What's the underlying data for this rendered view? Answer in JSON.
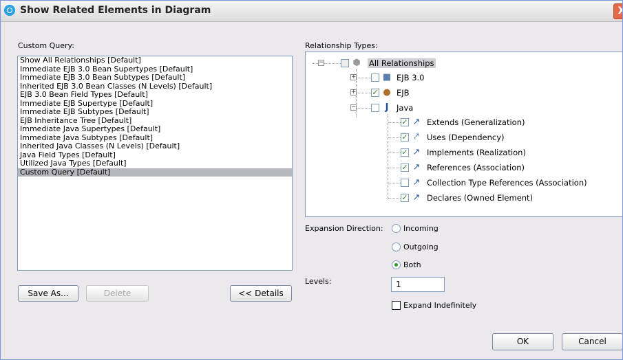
{
  "window": {
    "title": "Show Related Elements in Diagram",
    "close_glyph": "X"
  },
  "custom_query": {
    "label": "Custom Query:",
    "items": [
      "Show All Relationships [Default]",
      "Immediate EJB 3.0 Bean Supertypes [Default]",
      "Immediate EJB 3.0 Bean Subtypes [Default]",
      "Inherited EJB 3.0 Bean Classes (N Levels) [Default]",
      "EJB 3.0 Bean Field Types [Default]",
      "Immediate EJB Supertype [Default]",
      "Immediate EJB Subtypes [Default]",
      "EJB Inheritance Tree [Default]",
      "Immediate Java Supertypes [Default]",
      "Immediate Java Subtypes [Default]",
      "Inherited Java Classes (N Levels) [Default]",
      "Java Field Types [Default]",
      "Utilized Java Types [Default]",
      "Custom Query [Default]"
    ],
    "selected_item": "Custom Query [Default]"
  },
  "buttons": {
    "save_as": "Save As...",
    "delete": "Delete",
    "details": "<< Details",
    "ok": "OK",
    "cancel": "Cancel"
  },
  "relationship_types": {
    "label": "Relationship Types:",
    "root": "All Relationships",
    "ejb30": "EJB 3.0",
    "ejb": "EJB",
    "java": "Java",
    "java_children": [
      {
        "label": "Extends (Generalization)",
        "checked": true
      },
      {
        "label": "Uses (Dependency)",
        "checked": true
      },
      {
        "label": "Implements (Realization)",
        "checked": true
      },
      {
        "label": "References (Association)",
        "checked": true
      },
      {
        "label": "Collection Type References (Association)",
        "checked": false
      },
      {
        "label": "Declares (Owned Element)",
        "checked": true
      }
    ]
  },
  "expansion": {
    "label": "Expansion Direction:",
    "options": [
      "Incoming",
      "Outgoing",
      "Both"
    ],
    "selected": "Both"
  },
  "levels": {
    "label": "Levels:",
    "value": "1",
    "expand_indefinitely_label": "Expand Indefinitely",
    "expand_indefinitely_checked": false
  },
  "colors": {
    "accent": "#2aa2e0",
    "selection": "#b6b6bd",
    "check": "#2a7a2a"
  }
}
